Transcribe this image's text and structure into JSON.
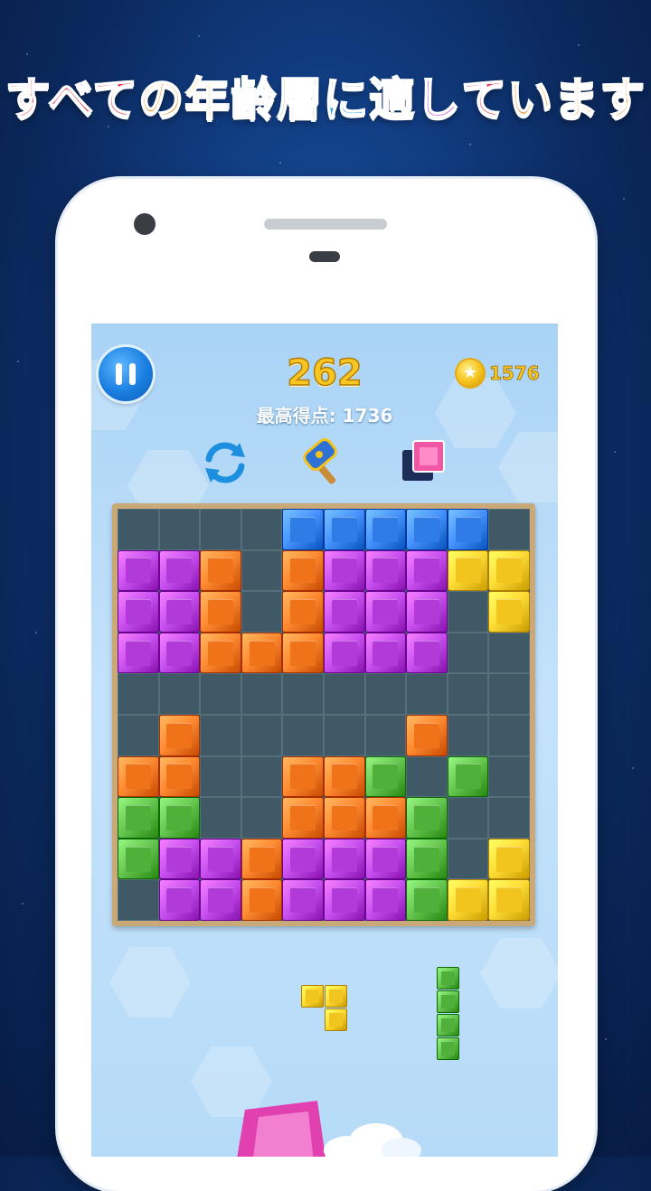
{
  "headline": {
    "segments": [
      {
        "text": "すべて",
        "color": "#e8233b"
      },
      {
        "text": "の",
        "color": "#f08a12"
      },
      {
        "text": "年",
        "color": "#f0b90c"
      },
      {
        "text": "齢",
        "color": "#5fb51b"
      },
      {
        "text": "層",
        "color": "#1ea05a"
      },
      {
        "text": "に",
        "color": "#1b9be0"
      },
      {
        "text": "適",
        "color": "#2366d8"
      },
      {
        "text": "し",
        "color": "#c53ad0"
      },
      {
        "text": "て",
        "color": "#e8233b"
      },
      {
        "text": "います",
        "color": "#f08a12"
      }
    ]
  },
  "game": {
    "score": "262",
    "best_score_label": "最高得点: 1736",
    "coins": "1576",
    "tools": [
      "refresh-icon",
      "hammer-icon",
      "swap-block-icon"
    ]
  },
  "colors": {
    "P": "#b13ad8",
    "O": "#f0731a",
    "B": "#2f7ce6",
    "Y": "#f2c51e",
    "G": "#4fb03a",
    "pink": "#f058a6"
  },
  "board": {
    "rows": [
      "....BBBBB.",
      "PPO.OPPPYY",
      "PPO.OPPP.Y",
      "PPOOOPPP..",
      "..........",
      ".O.....O..",
      "OO..OOG.G.",
      "GG..OOOG..",
      "GPPOPPPG.Y",
      ".PPOPPPGYY"
    ]
  },
  "next_pieces": [
    {
      "name": "yellow-t-piece",
      "color": "Y",
      "cells": [
        [
          0,
          0
        ],
        [
          0,
          1
        ],
        [
          1,
          1
        ]
      ]
    },
    {
      "name": "green-i-piece",
      "color": "G",
      "cells": [
        [
          0,
          0
        ],
        [
          1,
          0
        ],
        [
          2,
          0
        ],
        [
          3,
          0
        ]
      ]
    }
  ]
}
